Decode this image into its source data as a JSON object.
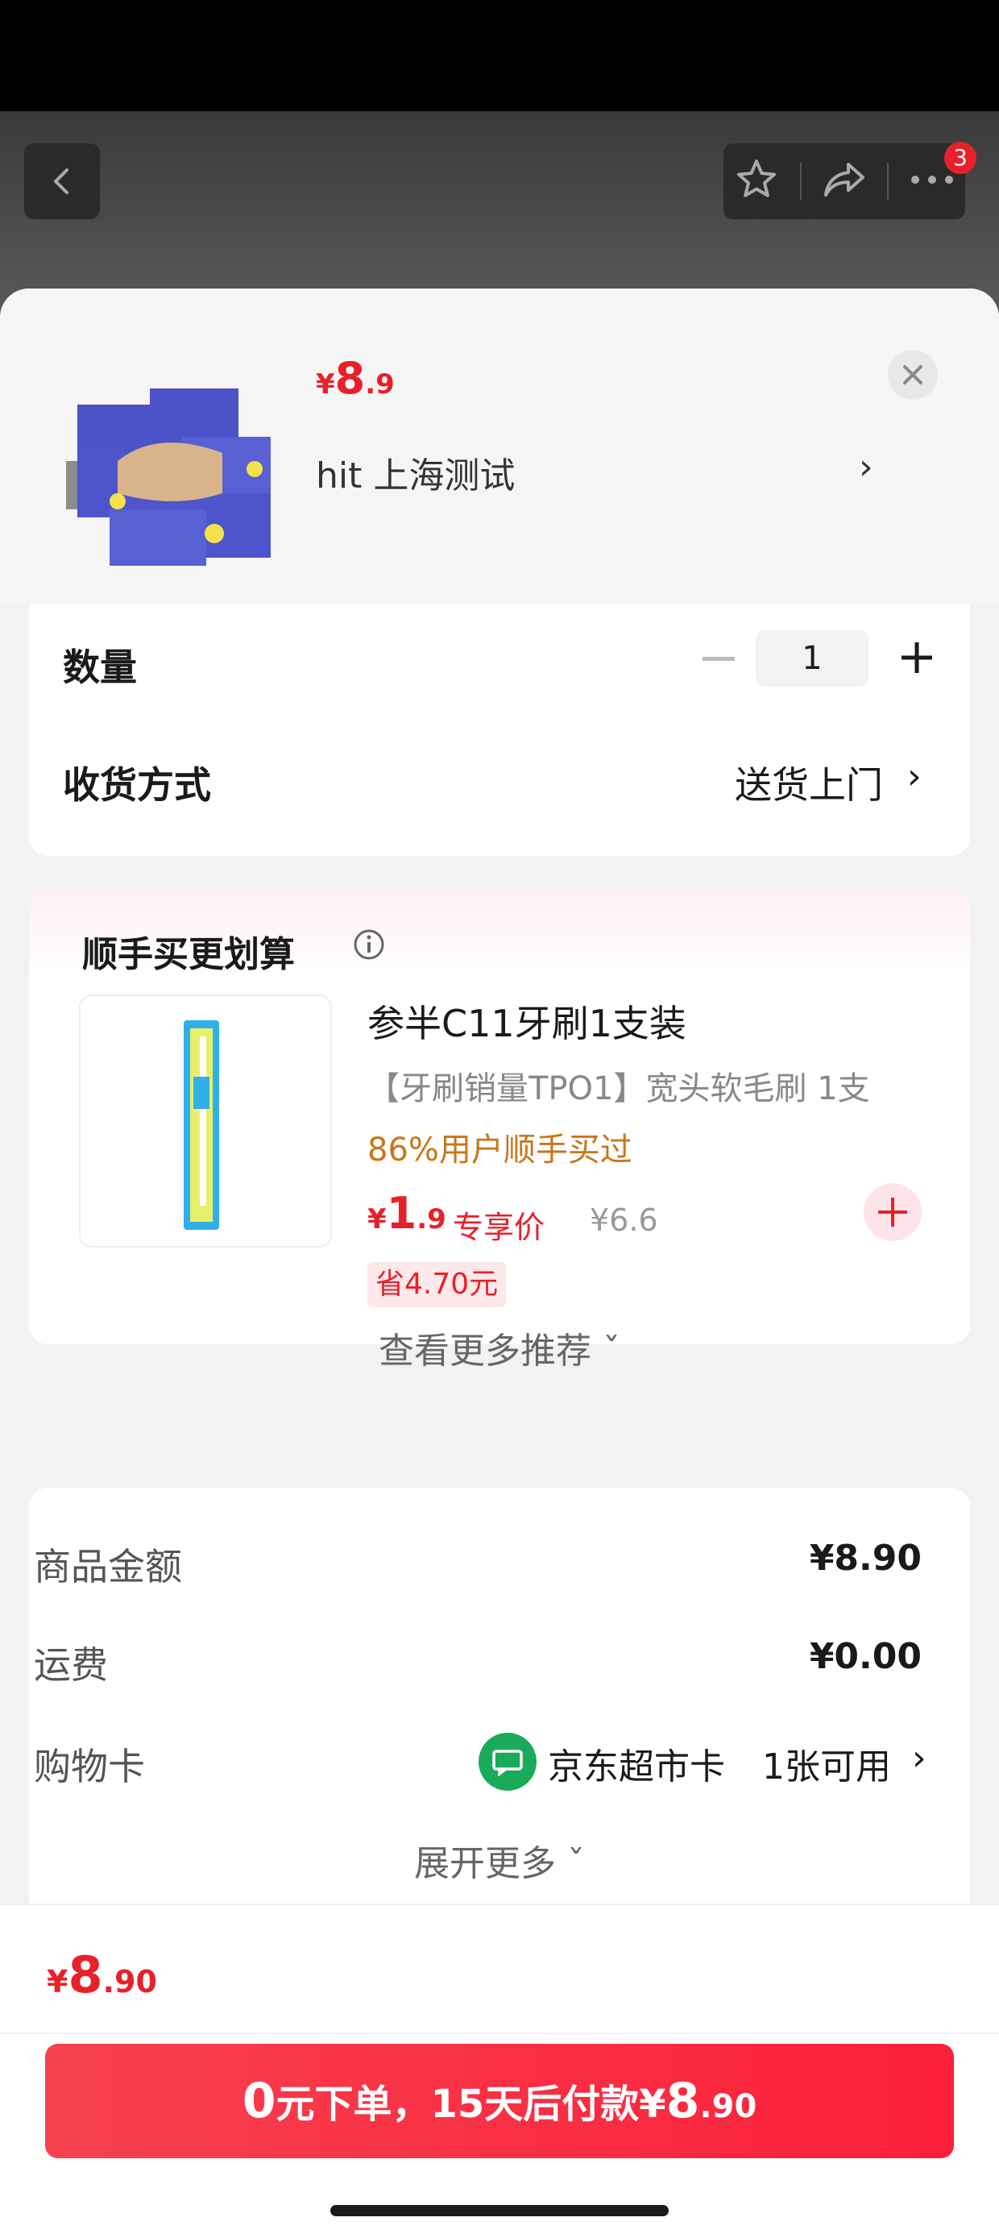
{
  "nav": {
    "badge_count": "3"
  },
  "product": {
    "price_currency": "¥",
    "price_int": "8",
    "price_dec": ".9",
    "address": "hit  上海测试",
    "address_chevron": "›"
  },
  "quantity": {
    "label": "数量",
    "value": "1"
  },
  "delivery": {
    "label": "收货方式",
    "value": "送货上门",
    "chevron": "›"
  },
  "recommend": {
    "title": "顺手买更划算",
    "item": {
      "name": "参半C11牙刷1支装",
      "desc": "【牙刷销量TPO1】宽头软毛刷 1支",
      "stat": "86%用户顺手买过",
      "price_currency": "¥",
      "price_int": "1",
      "price_dec": ".9",
      "price_tag": "专享价",
      "original_price": "¥6.6",
      "save_label": "省4.70元"
    },
    "more_label": "查看更多推荐 ˇ"
  },
  "summary": {
    "goods_label": "商品金额",
    "goods_value": "¥8.90",
    "shipping_label": "运费",
    "shipping_value": "¥0.00",
    "card_label": "购物卡",
    "card_name": "京东超市卡",
    "card_avail": "1张可用",
    "card_chevron": "›",
    "expand_label": "展开更多 ˇ"
  },
  "footer": {
    "price_currency": "¥",
    "price_int": "8",
    "price_dec": ".90",
    "pay_part1": "0",
    "pay_part2": "元下单，15天后付款¥",
    "pay_part3": "8",
    "pay_part4": ".90"
  },
  "colors": {
    "accent_red": "#e8202a",
    "stat_orange": "#c8761b",
    "card_green": "#1aab5a"
  }
}
